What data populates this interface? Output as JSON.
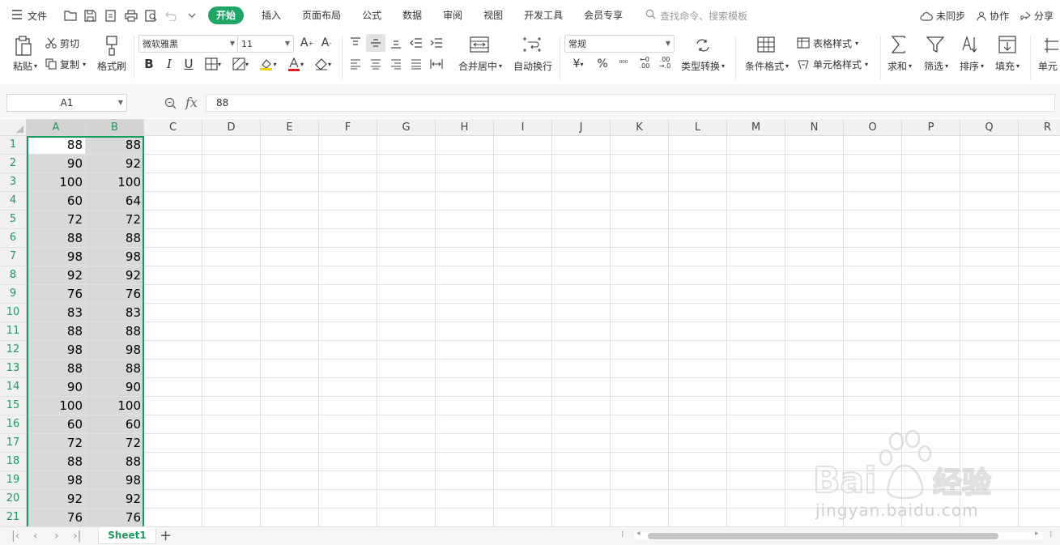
{
  "menubar": {
    "file_label": "文件",
    "tabs": [
      "开始",
      "插入",
      "页面布局",
      "公式",
      "数据",
      "审阅",
      "视图",
      "开发工具",
      "会员专享"
    ],
    "search_placeholder": "查找命令、搜索模板",
    "unsync_label": "未同步",
    "collab_label": "协作",
    "share_label": "分享"
  },
  "ribbon": {
    "paste": "粘贴",
    "cut": "剪切",
    "copy": "复制",
    "format_painter": "格式刷",
    "font_name": "微软雅黑",
    "font_size": "11",
    "merge_center": "合并居中",
    "wrap_text": "自动换行",
    "number_format": "常规",
    "convert_type": "类型转换",
    "cond_format": "条件格式",
    "table_style": "表格样式",
    "cell_style": "单元格样式",
    "sum": "求和",
    "filter": "筛选",
    "sort": "排序",
    "fill": "填充",
    "cell": "单元"
  },
  "formula_bar": {
    "name_box": "A1",
    "fx": "fx",
    "value": "88"
  },
  "columns": [
    "A",
    "B",
    "C",
    "D",
    "E",
    "F",
    "G",
    "H",
    "I",
    "J",
    "K",
    "L",
    "M",
    "N",
    "O",
    "P",
    "Q",
    "R"
  ],
  "rows": [
    {
      "n": "1",
      "a": "88",
      "b": "88"
    },
    {
      "n": "2",
      "a": "90",
      "b": "92"
    },
    {
      "n": "3",
      "a": "100",
      "b": "100"
    },
    {
      "n": "4",
      "a": "60",
      "b": "64"
    },
    {
      "n": "5",
      "a": "72",
      "b": "72"
    },
    {
      "n": "6",
      "a": "88",
      "b": "88"
    },
    {
      "n": "7",
      "a": "98",
      "b": "98"
    },
    {
      "n": "8",
      "a": "92",
      "b": "92"
    },
    {
      "n": "9",
      "a": "76",
      "b": "76"
    },
    {
      "n": "10",
      "a": "83",
      "b": "83"
    },
    {
      "n": "11",
      "a": "88",
      "b": "88"
    },
    {
      "n": "12",
      "a": "98",
      "b": "98"
    },
    {
      "n": "13",
      "a": "88",
      "b": "88"
    },
    {
      "n": "14",
      "a": "90",
      "b": "90"
    },
    {
      "n": "15",
      "a": "100",
      "b": "100"
    },
    {
      "n": "16",
      "a": "60",
      "b": "60"
    },
    {
      "n": "17",
      "a": "72",
      "b": "72"
    },
    {
      "n": "18",
      "a": "88",
      "b": "88"
    },
    {
      "n": "19",
      "a": "98",
      "b": "98"
    },
    {
      "n": "20",
      "a": "92",
      "b": "92"
    },
    {
      "n": "21",
      "a": "76",
      "b": "76"
    }
  ],
  "sheets": [
    "Sheet1"
  ],
  "watermark": "jingyan.baidu.com",
  "colors": {
    "accent": "#1c9b5e",
    "tab_active": "#1fa667",
    "selection": "#d9d9d9"
  }
}
